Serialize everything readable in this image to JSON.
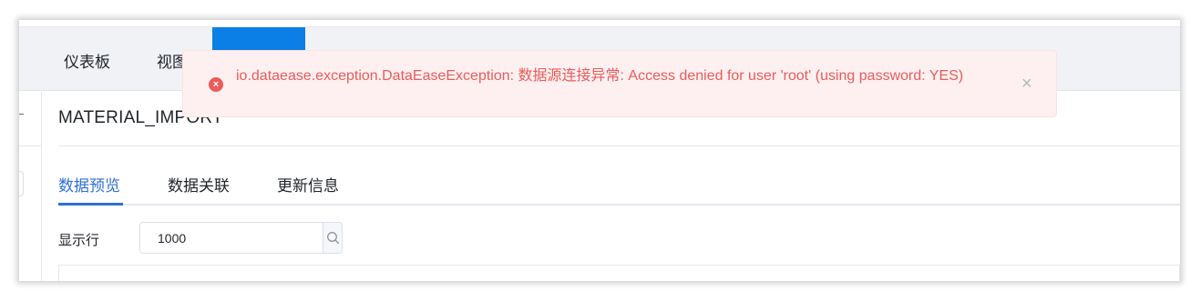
{
  "nav": {
    "items": [
      {
        "label": "仪表板"
      },
      {
        "label": "视图"
      }
    ]
  },
  "dataset": {
    "title": "MATERIAL_IMPORT"
  },
  "tabs": [
    {
      "label": "数据预览",
      "active": true
    },
    {
      "label": "数据关联",
      "active": false
    },
    {
      "label": "更新信息",
      "active": false
    }
  ],
  "preview": {
    "rows_label": "显示行",
    "rows_value": "1000"
  },
  "toast": {
    "type": "error",
    "message": "io.dataease.exception.DataEaseException: 数据源连接异常: Access denied for user 'root' (using password: YES)",
    "close_symbol": "×",
    "icon_symbol": "×"
  },
  "colors": {
    "accent": "#2f6fd6",
    "nav_active": "#0b7fe6",
    "error": "#ea5b5b",
    "error_bg": "#fef0f0"
  },
  "icons": {
    "error": "error-circle-icon",
    "close": "close-icon",
    "search": "search-icon"
  }
}
